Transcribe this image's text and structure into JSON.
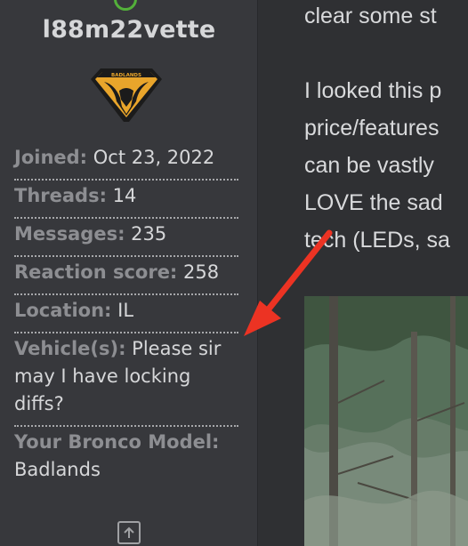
{
  "user": {
    "username": "l88m22vette",
    "badge_text": "BADLANDS",
    "fields": [
      {
        "label": "Joined:",
        "value": "Oct 23, 2022"
      },
      {
        "label": "Threads:",
        "value": "14"
      },
      {
        "label": "Messages:",
        "value": "235"
      },
      {
        "label": "Reaction score:",
        "value": "258"
      },
      {
        "label": "Location:",
        "value": "IL"
      },
      {
        "label": "Vehicle(s):",
        "value": "Please sir may I have locking diffs?"
      },
      {
        "label": "Your Bronco Model:",
        "value": "Badlands"
      }
    ]
  },
  "post": {
    "lines": [
      "clear some st",
      "I looked this p",
      "price/features",
      "can be vastly",
      "LOVE the sad",
      "tech (LEDs, sa"
    ]
  },
  "colors": {
    "panel_bg": "#37383c",
    "page_bg": "#2f3033",
    "online": "#53b03a",
    "arrow": "#ec3323"
  },
  "icons": {
    "scroll_top": "arrow-up-box-icon",
    "annotation": "red-arrow-icon"
  }
}
